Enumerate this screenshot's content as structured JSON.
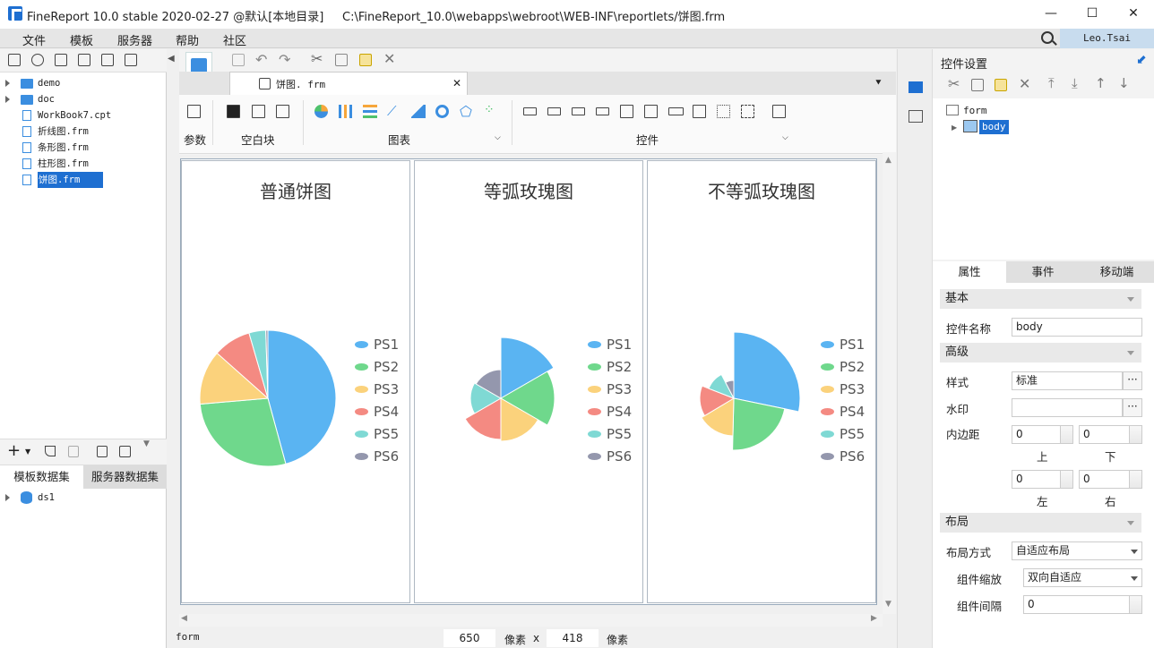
{
  "window": {
    "title": "FineReport 10.0 stable 2020-02-27 @默认[本地目录]     C:\\FineReport_10.0\\webapps\\webroot\\WEB-INF\\reportlets/饼图.frm",
    "min": "—",
    "max": "☐",
    "close": "✕"
  },
  "menu": [
    "文件",
    "模板",
    "服务器",
    "帮助",
    "社区"
  ],
  "user": "Leo.Tsai",
  "tree": [
    {
      "label": "demo",
      "kind": "folder"
    },
    {
      "label": "doc",
      "kind": "folder"
    },
    {
      "label": "WorkBook7.cpt",
      "kind": "file"
    },
    {
      "label": "折线图.frm",
      "kind": "file"
    },
    {
      "label": "条形图.frm",
      "kind": "file"
    },
    {
      "label": "柱形图.frm",
      "kind": "file"
    },
    {
      "label": "饼图.frm",
      "kind": "file",
      "selected": true
    }
  ],
  "datasets": {
    "tabs": [
      "模板数据集",
      "服务器数据集"
    ],
    "items": [
      "ds1"
    ]
  },
  "editor": {
    "file_tab": "饼图. frm",
    "close": "✕"
  },
  "ribbon": {
    "groups": [
      "参数",
      "空白块",
      "图表",
      "控件"
    ]
  },
  "charts": [
    {
      "title": "普通饼图"
    },
    {
      "title": "等弧玫瑰图"
    },
    {
      "title": "不等弧玫瑰图"
    }
  ],
  "chart_data": [
    {
      "type": "pie",
      "title": "普通饼图",
      "categories": [
        "PS1",
        "PS2",
        "PS3",
        "PS4",
        "PS5",
        "PS6"
      ],
      "values": [
        46,
        28,
        13,
        9,
        4,
        0.5
      ]
    },
    {
      "type": "pie",
      "title": "等弧玫瑰图",
      "categories": [
        "PS1",
        "PS2",
        "PS3",
        "PS4",
        "PS5",
        "PS6"
      ],
      "values": [
        68,
        60,
        48,
        46,
        34,
        32
      ]
    },
    {
      "type": "pie",
      "title": "不等弧玫瑰图",
      "categories": [
        "PS1",
        "PS2",
        "PS3",
        "PS4",
        "PS5",
        "PS6"
      ],
      "values": [
        74,
        58,
        42,
        38,
        30,
        20
      ]
    }
  ],
  "legend": [
    "PS1",
    "PS2",
    "PS3",
    "PS4",
    "PS5",
    "PS6"
  ],
  "colors": {
    "ps1": "#5ab4f2",
    "ps2": "#6fd88c",
    "ps3": "#fbd27c",
    "ps4": "#f48a82",
    "ps5": "#7fd9d4",
    "ps6": "#9497ad",
    "accent": "#1e6fd1"
  },
  "status": {
    "root": "form",
    "width": "650",
    "unit1": "像素",
    "times": "x",
    "height": "418",
    "unit2": "像素"
  },
  "props": {
    "header": "控件设置",
    "tree": [
      "form",
      "body"
    ],
    "tabs": [
      "属性",
      "事件",
      "移动端"
    ],
    "sec_basic": "基本",
    "name_label": "控件名称",
    "name_value": "body",
    "sec_adv": "高级",
    "style_label": "样式",
    "style_value": "标准",
    "watermark_label": "水印",
    "padding_label": "内边距",
    "pad_top": "0",
    "pad_bottom": "0",
    "pad_left": "0",
    "pad_right": "0",
    "top": "上",
    "bottom": "下",
    "left": "左",
    "right": "右",
    "sec_layout": "布局",
    "layout_label": "布局方式",
    "layout_value": "自适应布局",
    "scale_label": "组件缩放",
    "scale_value": "双向自适应",
    "gap_label": "组件间隔",
    "gap_value": "0",
    "more": "···"
  }
}
